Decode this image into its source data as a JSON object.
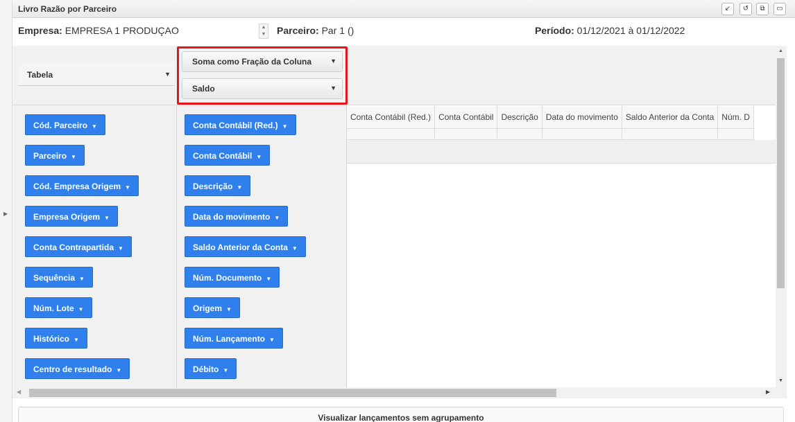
{
  "window": {
    "title": "Livro Razão por Parceiro",
    "controls": [
      "minimize-icon",
      "refresh-icon",
      "restore-icon",
      "maximize-icon"
    ]
  },
  "info": {
    "empresa_label": "Empresa:",
    "empresa_value": "EMPRESA 1 PRODUÇAO",
    "parceiro_label": "Parceiro:",
    "parceiro_value": "Par 1 ()",
    "periodo_label": "Período:",
    "periodo_value": "01/12/2021 à 01/12/2022"
  },
  "pivot": {
    "renderer": "Tabela",
    "aggregator": "Soma como Fração da Coluna",
    "value_field": "Saldo",
    "row_fields": [
      "Cód. Parceiro",
      "Parceiro",
      "Cód. Empresa Origem",
      "Empresa Origem",
      "Conta Contrapartida",
      "Sequência",
      "Núm. Lote",
      "Histórico",
      "Centro de resultado"
    ],
    "col_fields": [
      "Conta Contábil (Red.)",
      "Conta Contábil",
      "Descrição",
      "Data do movimento",
      "Saldo Anterior da Conta",
      "Núm. Documento",
      "Origem",
      "Núm. Lançamento",
      "Débito"
    ],
    "table_headers": [
      "Conta Contábil (Red.)",
      "Conta Contábil",
      "Descrição",
      "Data do movimento",
      "Saldo Anterior da Conta",
      "Núm. D"
    ]
  },
  "footer": {
    "button_label": "Visualizar lançamentos sem agrupamento"
  },
  "colors": {
    "field_button": "#2f80ed",
    "highlight_border": "#e3161b"
  }
}
